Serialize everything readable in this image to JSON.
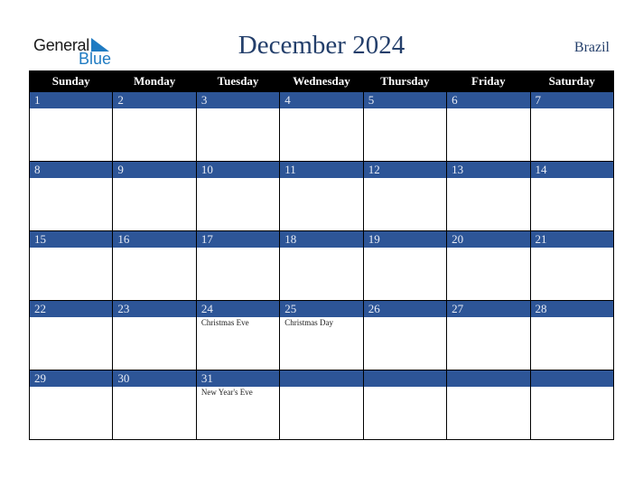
{
  "logo": {
    "word1": "General",
    "word2": "Blue",
    "icon": "triangle-flag-icon",
    "brand_color": "#1f7bc2"
  },
  "header": {
    "title": "December 2024",
    "country": "Brazil",
    "title_color": "#243f6b"
  },
  "colors": {
    "day_band": "#2d5597",
    "header_bg": "#000000"
  },
  "weekdays": [
    "Sunday",
    "Monday",
    "Tuesday",
    "Wednesday",
    "Thursday",
    "Friday",
    "Saturday"
  ],
  "weeks": [
    [
      {
        "day": "1",
        "holiday": ""
      },
      {
        "day": "2",
        "holiday": ""
      },
      {
        "day": "3",
        "holiday": ""
      },
      {
        "day": "4",
        "holiday": ""
      },
      {
        "day": "5",
        "holiday": ""
      },
      {
        "day": "6",
        "holiday": ""
      },
      {
        "day": "7",
        "holiday": ""
      }
    ],
    [
      {
        "day": "8",
        "holiday": ""
      },
      {
        "day": "9",
        "holiday": ""
      },
      {
        "day": "10",
        "holiday": ""
      },
      {
        "day": "11",
        "holiday": ""
      },
      {
        "day": "12",
        "holiday": ""
      },
      {
        "day": "13",
        "holiday": ""
      },
      {
        "day": "14",
        "holiday": ""
      }
    ],
    [
      {
        "day": "15",
        "holiday": ""
      },
      {
        "day": "16",
        "holiday": ""
      },
      {
        "day": "17",
        "holiday": ""
      },
      {
        "day": "18",
        "holiday": ""
      },
      {
        "day": "19",
        "holiday": ""
      },
      {
        "day": "20",
        "holiday": ""
      },
      {
        "day": "21",
        "holiday": ""
      }
    ],
    [
      {
        "day": "22",
        "holiday": ""
      },
      {
        "day": "23",
        "holiday": ""
      },
      {
        "day": "24",
        "holiday": "Christmas Eve"
      },
      {
        "day": "25",
        "holiday": "Christmas Day"
      },
      {
        "day": "26",
        "holiday": ""
      },
      {
        "day": "27",
        "holiday": ""
      },
      {
        "day": "28",
        "holiday": ""
      }
    ],
    [
      {
        "day": "29",
        "holiday": ""
      },
      {
        "day": "30",
        "holiday": ""
      },
      {
        "day": "31",
        "holiday": "New Year's Eve"
      },
      {
        "day": "",
        "holiday": ""
      },
      {
        "day": "",
        "holiday": ""
      },
      {
        "day": "",
        "holiday": ""
      },
      {
        "day": "",
        "holiday": ""
      }
    ]
  ]
}
